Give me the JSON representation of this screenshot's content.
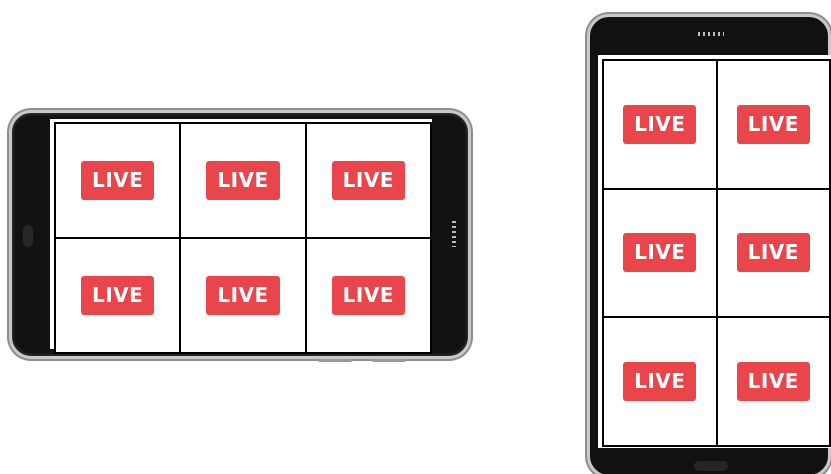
{
  "colors": {
    "badge": "#e9454b",
    "badge_text": "#ffffff",
    "phone_body": "#111111",
    "phone_rim": "#c9c9c9"
  },
  "landscape_phone": {
    "grid": {
      "rows": 2,
      "cols": 3,
      "cells": [
        {
          "label": "LIVE"
        },
        {
          "label": "LIVE"
        },
        {
          "label": "LIVE"
        },
        {
          "label": "LIVE"
        },
        {
          "label": "LIVE"
        },
        {
          "label": "LIVE"
        }
      ]
    }
  },
  "portrait_phone": {
    "grid": {
      "rows": 3,
      "cols": 2,
      "cells": [
        {
          "label": "LIVE"
        },
        {
          "label": "LIVE"
        },
        {
          "label": "LIVE"
        },
        {
          "label": "LIVE"
        },
        {
          "label": "LIVE"
        },
        {
          "label": "LIVE"
        }
      ]
    }
  }
}
